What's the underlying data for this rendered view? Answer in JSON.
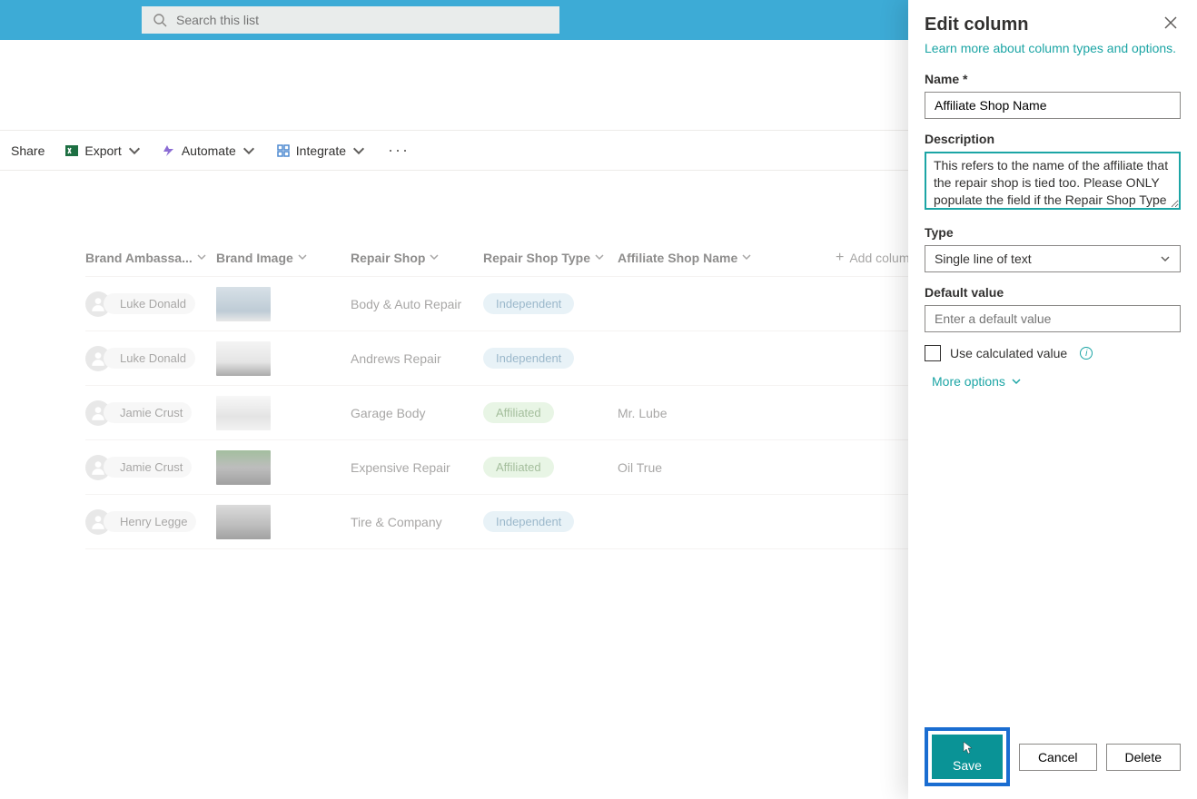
{
  "search": {
    "placeholder": "Search this list"
  },
  "toolbar": {
    "share": "Share",
    "export": "Export",
    "automate": "Automate",
    "integrate": "Integrate"
  },
  "columns": {
    "brand_ambassador": "Brand Ambassa...",
    "brand_image": "Brand Image",
    "repair_shop": "Repair Shop",
    "repair_shop_type": "Repair Shop Type",
    "affiliate_shop_name": "Affiliate Shop Name",
    "add_column": "Add column"
  },
  "rows": [
    {
      "person": "Luke Donald",
      "thumb_bg": "linear-gradient(180deg,#b8c8d4 0%,#8aa3b5 70%,#d6d6d6 100%)",
      "repair_shop": "Body & Auto Repair",
      "type": "Independent",
      "type_style": "blue",
      "affiliate": ""
    },
    {
      "person": "Luke Donald",
      "thumb_bg": "linear-gradient(180deg,#ececec 0%,#d0d0d0 60%,#666 100%)",
      "repair_shop": "Andrews Repair",
      "type": "Independent",
      "type_style": "blue",
      "affiliate": ""
    },
    {
      "person": "Jamie Crust",
      "thumb_bg": "linear-gradient(180deg,#f2f2f2 0%,#cfcfcf 60%,#e8e8e8 100%)",
      "repair_shop": "Garage Body",
      "type": "Affiliated",
      "type_style": "green",
      "affiliate": "Mr. Lube"
    },
    {
      "person": "Jamie Crust",
      "thumb_bg": "linear-gradient(180deg,#598a51 0%,#888 50%,#555 100%)",
      "repair_shop": "Expensive Repair",
      "type": "Affiliated",
      "type_style": "green",
      "affiliate": "Oil True"
    },
    {
      "person": "Henry Legge",
      "thumb_bg": "linear-gradient(180deg,#bfbfbf 0%,#888 60%,#555 100%)",
      "repair_shop": "Tire & Company",
      "type": "Independent",
      "type_style": "blue",
      "affiliate": ""
    }
  ],
  "panel": {
    "title": "Edit column",
    "learn_more": "Learn more about column types and options.",
    "name_label": "Name *",
    "name_value": "Affiliate Shop Name",
    "description_label": "Description",
    "description_value": "This refers to the name of the affiliate that the repair shop is tied too. Please ONLY populate the field if the Repair Shop Type is \"Affiliate\"",
    "type_label": "Type",
    "type_value": "Single line of text",
    "default_label": "Default value",
    "default_placeholder": "Enter a default value",
    "calculated_label": "Use calculated value",
    "more_options": "More options",
    "save": "Save",
    "cancel": "Cancel",
    "delete": "Delete"
  }
}
